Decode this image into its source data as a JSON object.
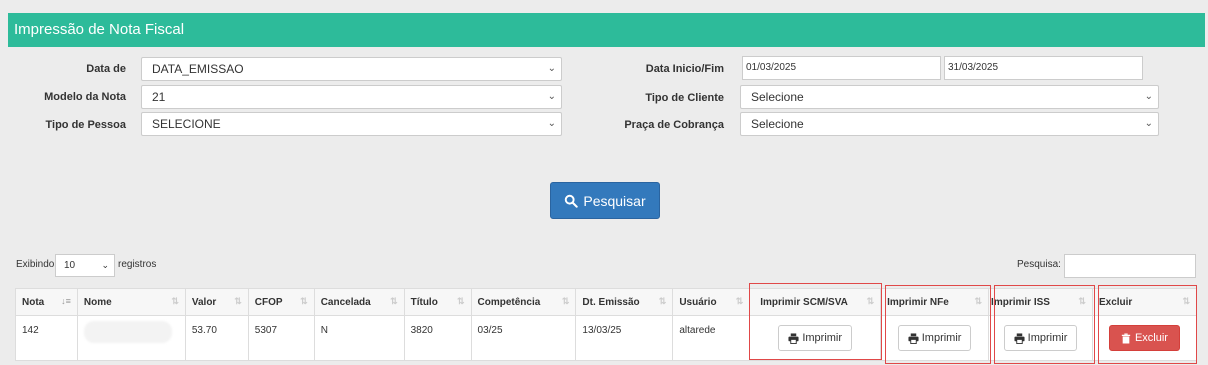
{
  "panel": {
    "title": "Impressão de Nota Fiscal"
  },
  "form": {
    "data_de": {
      "label": "Data de",
      "value": "DATA_EMISSAO"
    },
    "modelo": {
      "label": "Modelo da Nota",
      "value": "21"
    },
    "tipo_pessoa": {
      "label": "Tipo de Pessoa",
      "value": "SELECIONE"
    },
    "data_inicio_fim": {
      "label": "Data Inicio/Fim",
      "inicio": "01/03/2025",
      "fim": "31/03/2025"
    },
    "tipo_cliente": {
      "label": "Tipo de Cliente",
      "value": "Selecione"
    },
    "praca": {
      "label": "Praça de Cobrança",
      "value": "Selecione"
    },
    "search_button": "Pesquisar"
  },
  "table_controls": {
    "showing": "Exibindo",
    "length_value": "10",
    "records": "registros",
    "search_label": "Pesquisa:"
  },
  "table": {
    "headers": [
      "Nota",
      "Nome",
      "Valor",
      "CFOP",
      "Cancelada",
      "Título",
      "Competência",
      "Dt. Emissão",
      "Usuário",
      "Imprimir SCM/SVA",
      "Imprimir NFe",
      "Imprimir ISS",
      "Excluir"
    ],
    "rows": [
      {
        "nota": "142",
        "nome": "",
        "valor": "53.70",
        "cfop": "5307",
        "cancelada": "N",
        "titulo": "3820",
        "competencia": "03/25",
        "emissao": "13/03/25",
        "usuario": "altarede",
        "print_scm": "Imprimir",
        "print_nfe": "Imprimir",
        "print_iss": "Imprimir",
        "excluir": "Excluir"
      }
    ]
  },
  "colors": {
    "header": "#2dbb9a",
    "primary": "#3379bc",
    "danger": "#d9534f",
    "highlight": "#e04848"
  },
  "icons": [
    "search-icon",
    "print-icon",
    "trash-icon",
    "chevron-down-icon",
    "sort-icon"
  ]
}
